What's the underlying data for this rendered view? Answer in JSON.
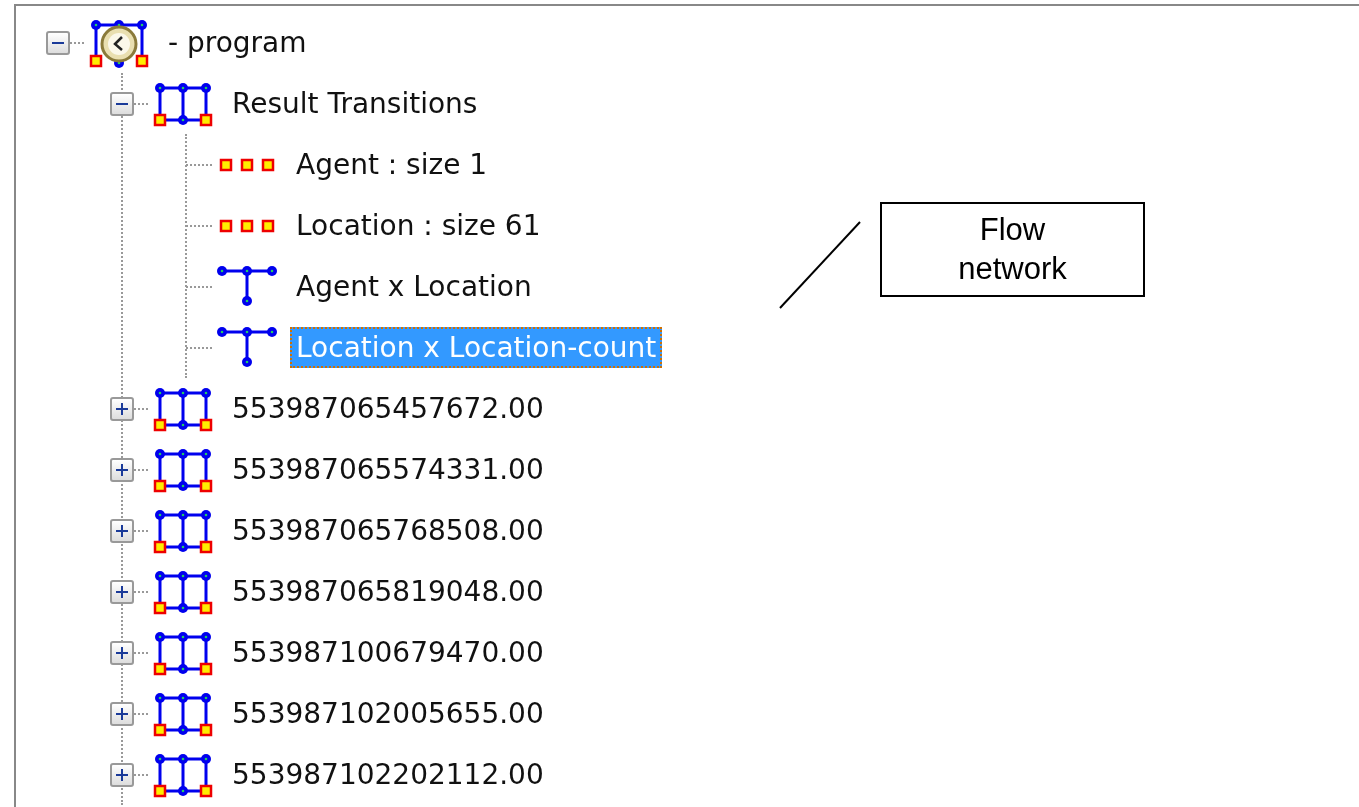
{
  "tree": [
    {
      "kind": "program",
      "label": "- program",
      "expanded": true,
      "selected": false,
      "children": [
        {
          "kind": "graph",
          "label": "Result Transitions",
          "expanded": true,
          "selected": false,
          "children": [
            {
              "kind": "nodeset",
              "label": "Agent : size 1",
              "selected": false
            },
            {
              "kind": "nodeset",
              "label": "Location : size 61",
              "selected": false
            },
            {
              "kind": "network",
              "label": "Agent x Location",
              "selected": false
            },
            {
              "kind": "network",
              "label": "Location x Location-count",
              "selected": true
            }
          ]
        },
        {
          "kind": "graph",
          "label": "553987065457672.00",
          "expanded": false,
          "selected": false
        },
        {
          "kind": "graph",
          "label": "553987065574331.00",
          "expanded": false,
          "selected": false
        },
        {
          "kind": "graph",
          "label": "553987065768508.00",
          "expanded": false,
          "selected": false
        },
        {
          "kind": "graph",
          "label": "553987065819048.00",
          "expanded": false,
          "selected": false
        },
        {
          "kind": "graph",
          "label": "553987100679470.00",
          "expanded": false,
          "selected": false
        },
        {
          "kind": "graph",
          "label": "553987102005655.00",
          "expanded": false,
          "selected": false
        },
        {
          "kind": "graph",
          "label": "553987102202112.00",
          "expanded": false,
          "selected": false
        }
      ]
    }
  ],
  "callout": {
    "text": "Flow network"
  }
}
